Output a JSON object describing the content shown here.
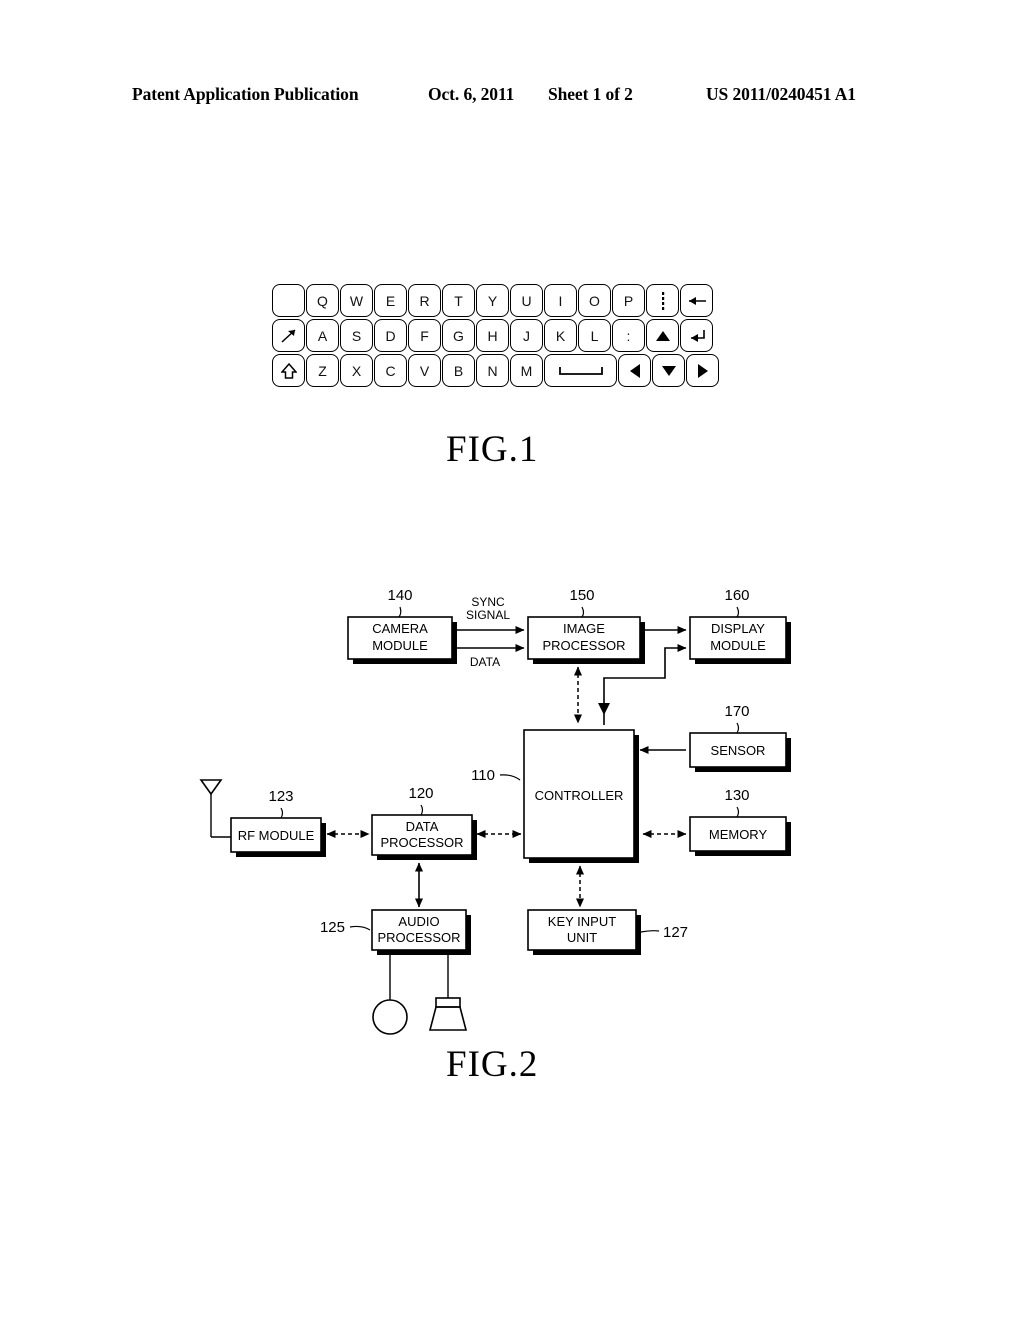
{
  "header": {
    "publication": "Patent Application Publication",
    "date": "Oct. 6, 2011",
    "sheet": "Sheet 1 of 2",
    "patent_number": "US 2011/0240451 A1"
  },
  "figures": {
    "fig1_caption": "FIG.1",
    "fig2_caption": "FIG.2"
  },
  "keyboard": {
    "rows": [
      [
        {
          "label": "",
          "icon": "blank-key",
          "type": "blank"
        },
        {
          "label": "Q",
          "type": "char"
        },
        {
          "label": "W",
          "type": "char"
        },
        {
          "label": "E",
          "type": "char"
        },
        {
          "label": "R",
          "type": "char"
        },
        {
          "label": "T",
          "type": "char"
        },
        {
          "label": "Y",
          "type": "char"
        },
        {
          "label": "U",
          "type": "char"
        },
        {
          "label": "I",
          "type": "char"
        },
        {
          "label": "O",
          "type": "char"
        },
        {
          "label": "P",
          "type": "char"
        },
        {
          "label": "⋮",
          "icon": "vertical-ellipsis-icon",
          "type": "symbol"
        },
        {
          "label": "←",
          "icon": "backspace-arrow-icon",
          "type": "symbol"
        }
      ],
      [
        {
          "label": "↗",
          "icon": "tab-diagonal-arrow-icon",
          "type": "symbol"
        },
        {
          "label": "A",
          "type": "char"
        },
        {
          "label": "S",
          "type": "char"
        },
        {
          "label": "D",
          "type": "char"
        },
        {
          "label": "F",
          "type": "char"
        },
        {
          "label": "G",
          "type": "char"
        },
        {
          "label": "H",
          "type": "char"
        },
        {
          "label": "J",
          "type": "char"
        },
        {
          "label": "K",
          "type": "char"
        },
        {
          "label": "L",
          "type": "char"
        },
        {
          "label": ":",
          "type": "char"
        },
        {
          "label": "▲",
          "icon": "arrow-up-triangle-icon",
          "type": "symbol"
        },
        {
          "label": "↵",
          "icon": "enter-return-arrow-icon",
          "type": "symbol"
        }
      ],
      [
        {
          "label": "⇧",
          "icon": "shift-arrow-icon",
          "type": "symbol"
        },
        {
          "label": "Z",
          "type": "char"
        },
        {
          "label": "X",
          "type": "char"
        },
        {
          "label": "C",
          "type": "char"
        },
        {
          "label": "V",
          "type": "char"
        },
        {
          "label": "B",
          "type": "char"
        },
        {
          "label": "N",
          "type": "char"
        },
        {
          "label": "M",
          "type": "char"
        },
        {
          "label": "␣",
          "icon": "space-bar-icon",
          "type": "space"
        },
        {
          "label": "◀",
          "icon": "arrow-left-triangle-icon",
          "type": "symbol"
        },
        {
          "label": "▼",
          "icon": "arrow-down-triangle-icon",
          "type": "symbol"
        },
        {
          "label": "▶",
          "icon": "arrow-right-triangle-icon",
          "type": "symbol"
        }
      ]
    ]
  },
  "block_diagram": {
    "blocks": [
      {
        "id": "camera_module",
        "label_line1": "CAMERA",
        "label_line2": "MODULE",
        "ref": "140"
      },
      {
        "id": "image_processor",
        "label_line1": "IMAGE",
        "label_line2": "PROCESSOR",
        "ref": "150"
      },
      {
        "id": "display_module",
        "label_line1": "DISPLAY",
        "label_line2": "MODULE",
        "ref": "160"
      },
      {
        "id": "controller",
        "label_line1": "CONTROLLER",
        "label_line2": "",
        "ref": "110"
      },
      {
        "id": "sensor",
        "label_line1": "SENSOR",
        "label_line2": "",
        "ref": "170"
      },
      {
        "id": "memory",
        "label_line1": "MEMORY",
        "label_line2": "",
        "ref": "130"
      },
      {
        "id": "rf_module",
        "label_line1": "RF MODULE",
        "label_line2": "",
        "ref": "123"
      },
      {
        "id": "data_processor",
        "label_line1": "DATA",
        "label_line2": "PROCESSOR",
        "ref": "120"
      },
      {
        "id": "audio_processor",
        "label_line1": "AUDIO",
        "label_line2": "PROCESSOR",
        "ref": "125"
      },
      {
        "id": "key_input_unit",
        "label_line1": "KEY INPUT",
        "label_line2": "UNIT",
        "ref": "127"
      }
    ],
    "signal_labels": {
      "sync_line1": "SYNC",
      "sync_line2": "SIGNAL",
      "data": "DATA"
    },
    "icons": {
      "antenna": "antenna-icon",
      "microphone": "microphone-icon",
      "speaker": "speaker-icon"
    }
  },
  "colors": {
    "ink": "#000000",
    "paper": "#ffffff"
  }
}
